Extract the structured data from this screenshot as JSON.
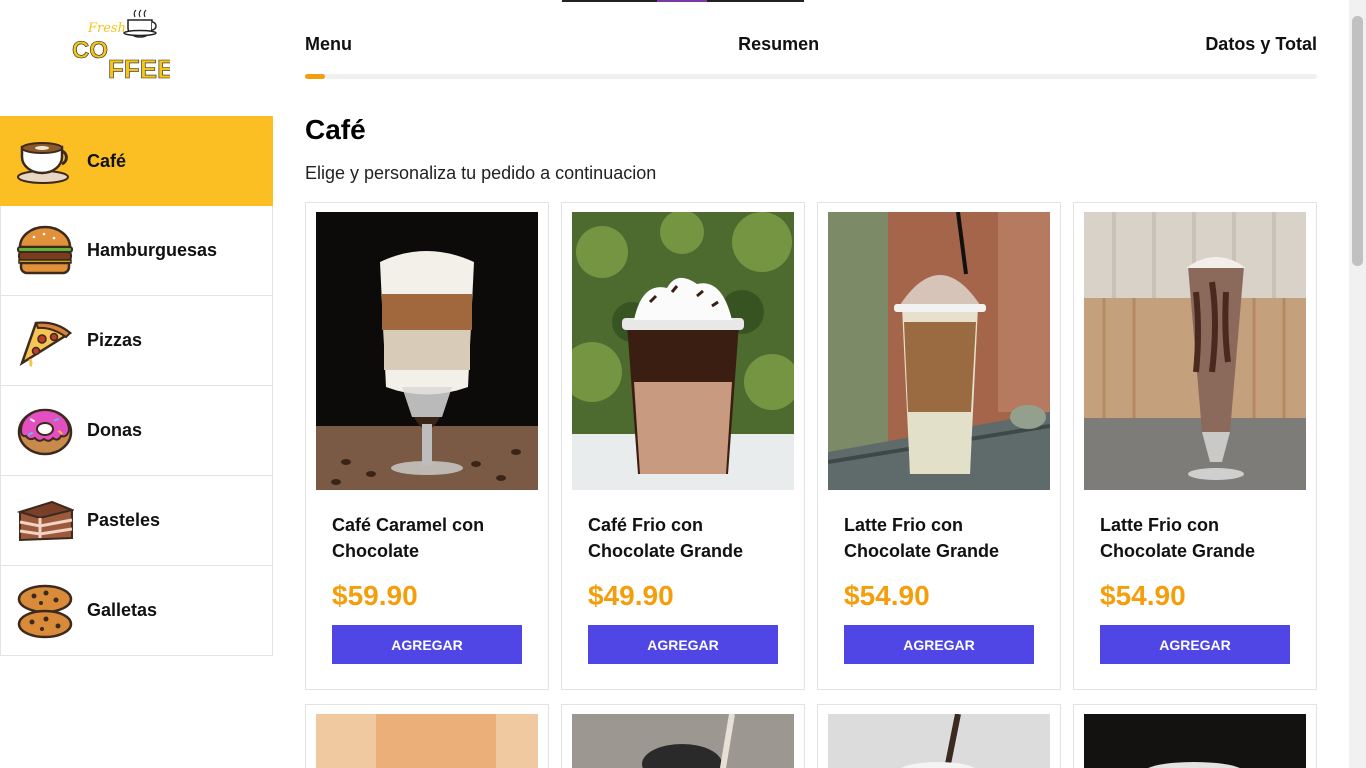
{
  "brand": {
    "logo_small": "Fresh",
    "logo_big": "COFFEE"
  },
  "steps": [
    "Menu",
    "Resumen",
    "Datos y Total"
  ],
  "progress_fraction": 0.02,
  "sidebar": {
    "items": [
      {
        "label": "Café",
        "icon": "coffee-cup-icon",
        "active": true
      },
      {
        "label": "Hamburguesas",
        "icon": "burger-icon"
      },
      {
        "label": "Pizzas",
        "icon": "pizza-slice-icon"
      },
      {
        "label": "Donas",
        "icon": "donut-icon"
      },
      {
        "label": "Pasteles",
        "icon": "cake-slice-icon"
      },
      {
        "label": "Galletas",
        "icon": "cookies-icon"
      }
    ]
  },
  "main": {
    "title": "Café",
    "subtitle": "Elige y personaliza tu pedido a continuacion"
  },
  "products": [
    {
      "name": "Café Caramel con Chocolate",
      "price": "$59.90",
      "button": "AGREGAR"
    },
    {
      "name": "Café Frio con Chocolate Grande",
      "price": "$49.90",
      "button": "AGREGAR"
    },
    {
      "name": "Latte Frio con Chocolate Grande",
      "price": "$54.90",
      "button": "AGREGAR"
    },
    {
      "name": "Latte Frio con Chocolate Grande",
      "price": "$54.90",
      "button": "AGREGAR"
    }
  ],
  "colors": {
    "accent": "#fbbf24",
    "price": "#f59e0b",
    "button": "#4f46e5"
  }
}
